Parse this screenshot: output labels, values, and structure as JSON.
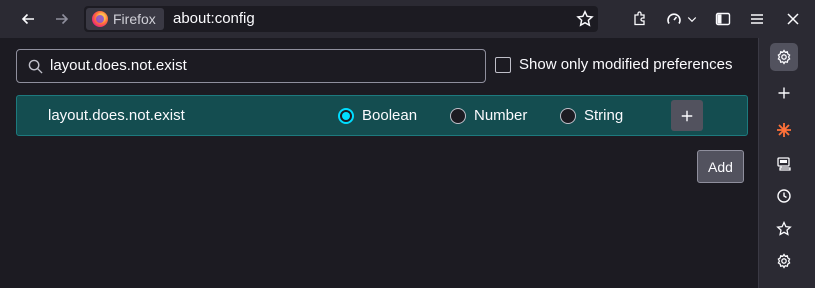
{
  "toolbar": {
    "identity_label": "Firefox",
    "url": "about:config",
    "icons": [
      "back-icon",
      "forward-icon",
      "firefox-logo-icon",
      "bookmark-star-icon",
      "extensions-icon",
      "speedometer-icon",
      "chevron-down-icon",
      "sidebar-toggle-icon",
      "menu-icon",
      "close-icon"
    ]
  },
  "search": {
    "value": "layout.does.not.exist",
    "modified_only_label": "Show only modified preferences",
    "modified_only_checked": false
  },
  "new_pref": {
    "name": "layout.does.not.exist",
    "types": [
      {
        "label": "Boolean",
        "checked": true
      },
      {
        "label": "Number",
        "checked": false
      },
      {
        "label": "String",
        "checked": false
      }
    ]
  },
  "add_button_label": "Add",
  "sidebar": {
    "items": [
      "settings-icon",
      "plus-icon",
      "burst-icon",
      "synced-tabs-icon",
      "history-icon",
      "bookmarks-icon",
      "customize-icon"
    ],
    "active_index": 0
  },
  "colors": {
    "toolbar": "#2b2a33",
    "page": "#1c1b22",
    "row_highlight": "#144d50",
    "accent": "#00ddff",
    "burst_icon": "#ff7139"
  }
}
